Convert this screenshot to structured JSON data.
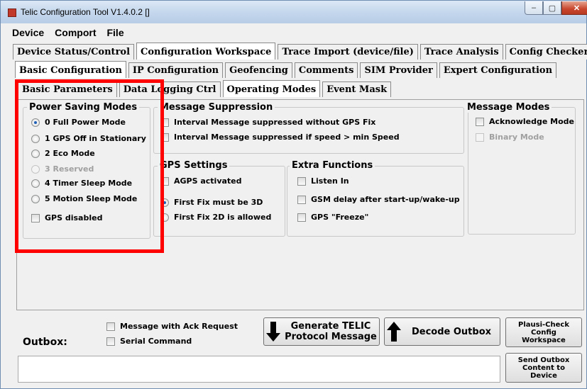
{
  "window": {
    "title": "Telic Configuration Tool V1.4.0.2 []",
    "controls": {
      "minimize": "–",
      "maximize": "▢",
      "close": "✕"
    }
  },
  "menu": [
    "Device",
    "Comport",
    "File"
  ],
  "tabs_main": [
    {
      "label": "Device Status/Control",
      "active": false
    },
    {
      "label": "Configuration Workspace",
      "active": true
    },
    {
      "label": "Trace Import (device/file)",
      "active": false
    },
    {
      "label": "Trace Analysis",
      "active": false
    },
    {
      "label": "Config Checker",
      "active": false
    }
  ],
  "tabs_config": [
    {
      "label": "Basic Configuration",
      "active": true
    },
    {
      "label": "IP Configuration",
      "active": false
    },
    {
      "label": "Geofencing",
      "active": false
    },
    {
      "label": "Comments",
      "active": false
    },
    {
      "label": "SIM Provider",
      "active": false
    },
    {
      "label": "Expert Configuration",
      "active": false
    }
  ],
  "tabs_basic": [
    {
      "label": "Basic Parameters",
      "active": false
    },
    {
      "label": "Data Logging Ctrl",
      "active": false
    },
    {
      "label": "Operating Modes",
      "active": true
    },
    {
      "label": "Event Mask",
      "active": false
    }
  ],
  "power_saving": {
    "title": "Power Saving Modes",
    "options": [
      {
        "label": "0 Full Power Mode",
        "selected": true,
        "enabled": true
      },
      {
        "label": "1 GPS Off in Stationary",
        "selected": false,
        "enabled": true
      },
      {
        "label": "2 Eco Mode",
        "selected": false,
        "enabled": true
      },
      {
        "label": "3 Reserved",
        "selected": false,
        "enabled": false
      },
      {
        "label": "4 Timer Sleep Mode",
        "selected": false,
        "enabled": true
      },
      {
        "label": "5 Motion Sleep Mode",
        "selected": false,
        "enabled": true
      }
    ],
    "gps_disabled": "GPS disabled"
  },
  "message_suppression": {
    "title": "Message Suppression",
    "options": [
      "Interval Message suppressed without GPS Fix",
      "Interval Message suppressed if speed > min Speed"
    ]
  },
  "message_modes": {
    "title": "Message Modes",
    "acknowledge": "Acknowledge Mode",
    "binary": "Binary Mode"
  },
  "gps_settings": {
    "title": "GPS Settings",
    "agps": "AGPS activated",
    "fix3d": "First Fix must be 3D",
    "fix2d": "First Fix 2D is allowed"
  },
  "extra_functions": {
    "title": "Extra Functions",
    "options": [
      "Listen In",
      "GSM delay after start-up/wake-up",
      "GPS \"Freeze\""
    ]
  },
  "outbox": {
    "label": "Outbox:",
    "ack_request": "Message with Ack Request",
    "serial_command": "Serial Command",
    "generate_line1": "Generate TELIC",
    "generate_line2": "Protocol Message",
    "decode": "Decode Outbox",
    "plausi_1": "Plausi-Check",
    "plausi_2": "Config",
    "plausi_3": "Workspace",
    "send_1": "Send Outbox",
    "send_2": "Content to",
    "send_3": "Device"
  }
}
